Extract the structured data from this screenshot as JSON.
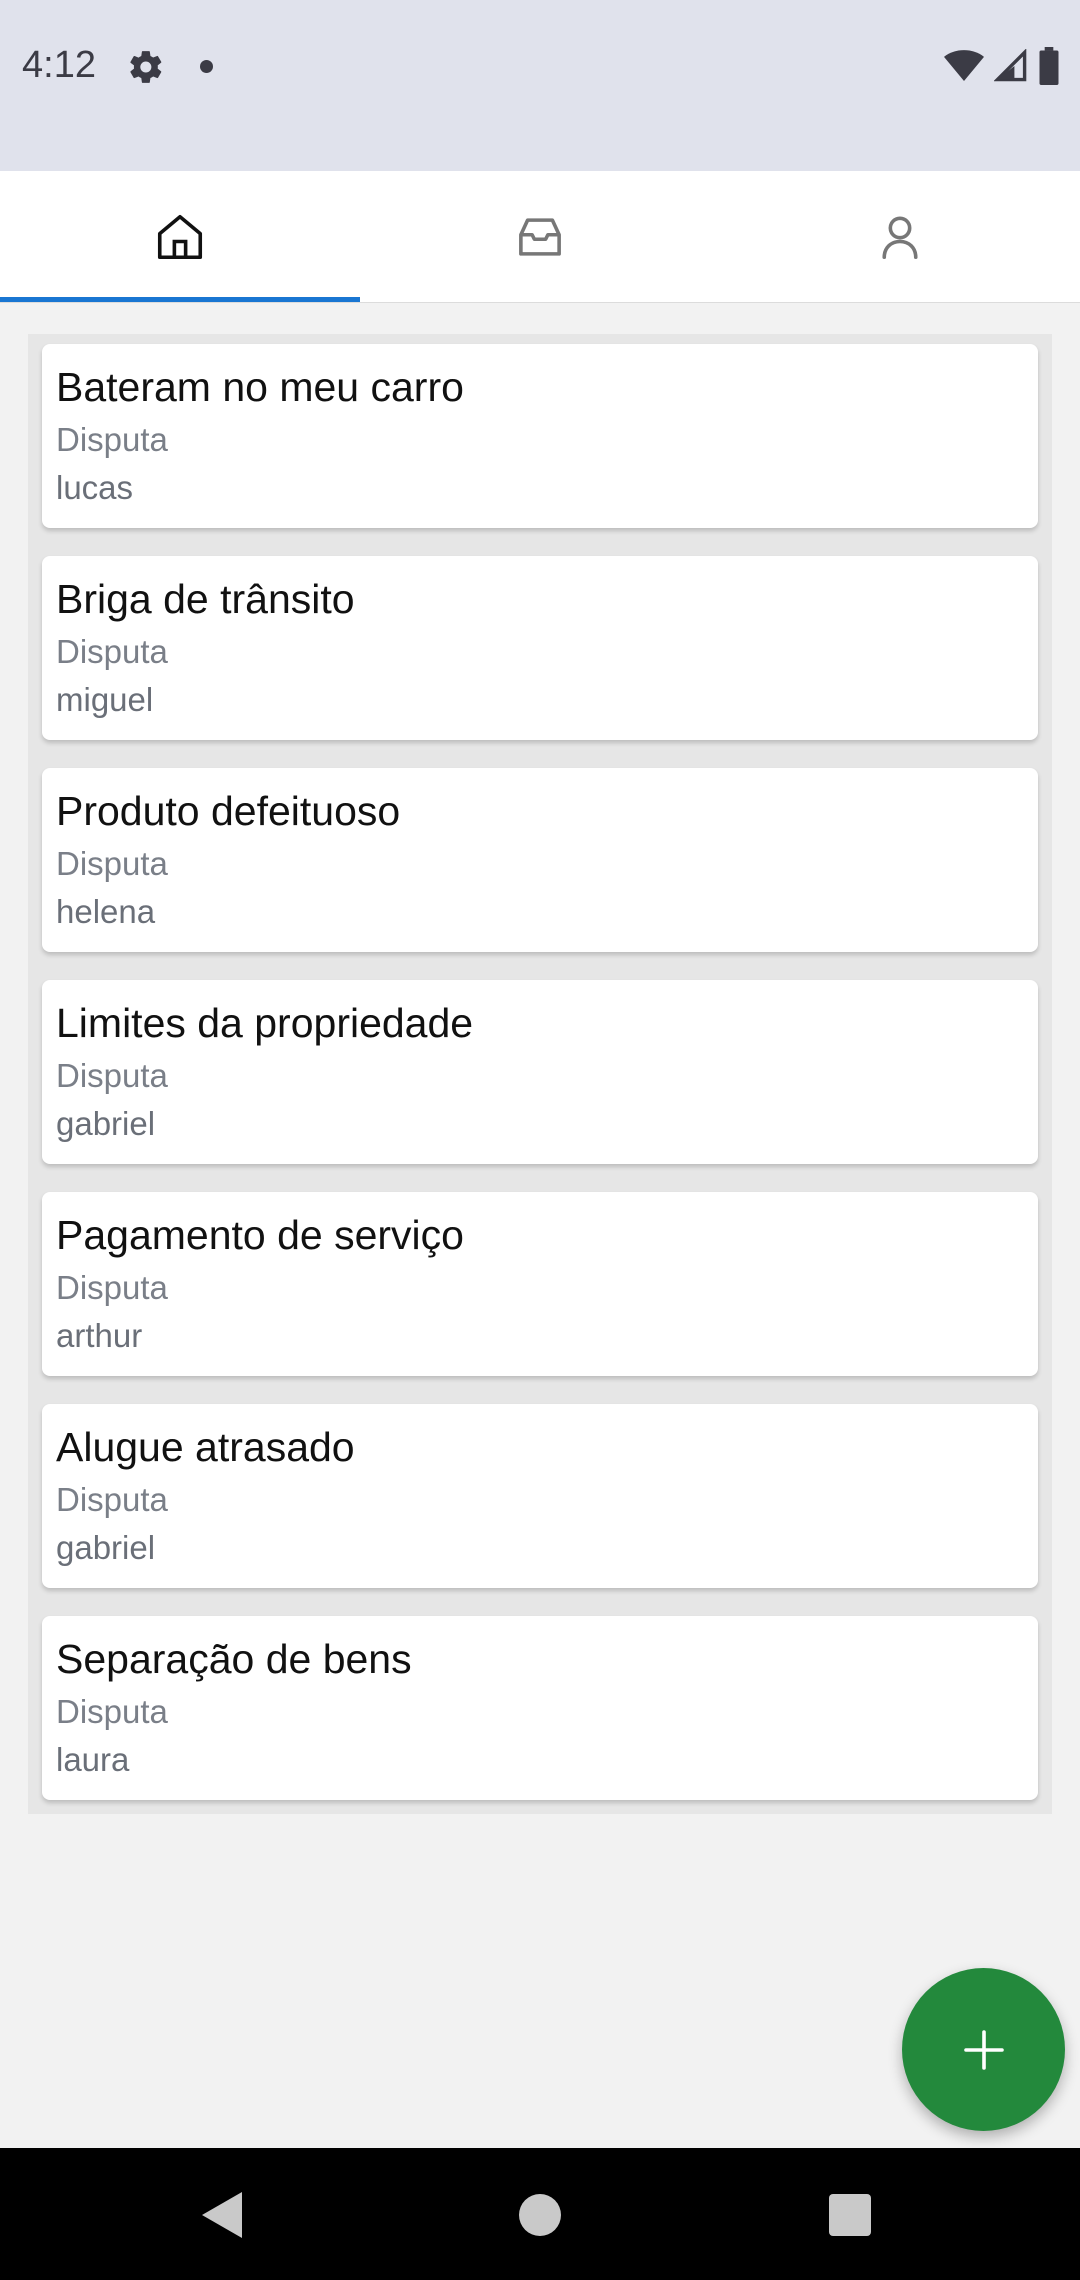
{
  "status_bar": {
    "time": "4:12",
    "icons_left": [
      "gear-icon",
      "notification-dot-icon"
    ],
    "icons_right": [
      "wifi-icon",
      "signal-icon",
      "battery-icon"
    ]
  },
  "tabs": [
    {
      "name": "home",
      "icon": "home-icon",
      "active": true
    },
    {
      "name": "inbox",
      "icon": "inbox-icon",
      "active": false
    },
    {
      "name": "profile",
      "icon": "user-icon",
      "active": false
    }
  ],
  "disputes": [
    {
      "title": "Bateram no meu carro",
      "type": "Disputa",
      "user": "lucas"
    },
    {
      "title": "Briga de trânsito",
      "type": "Disputa",
      "user": "miguel"
    },
    {
      "title": "Produto defeituoso",
      "type": "Disputa",
      "user": "helena"
    },
    {
      "title": "Limites da propriedade",
      "type": "Disputa",
      "user": "gabriel"
    },
    {
      "title": "Pagamento de serviço",
      "type": "Disputa",
      "user": "arthur"
    },
    {
      "title": "Alugue atrasado",
      "type": "Disputa",
      "user": "gabriel"
    },
    {
      "title": "Separação de bens",
      "type": "Disputa",
      "user": "laura"
    }
  ],
  "fab": {
    "icon": "plus-icon"
  },
  "colors": {
    "accent": "#1976d2",
    "fab": "#23893c",
    "status_bar": "#e0e2ec"
  }
}
